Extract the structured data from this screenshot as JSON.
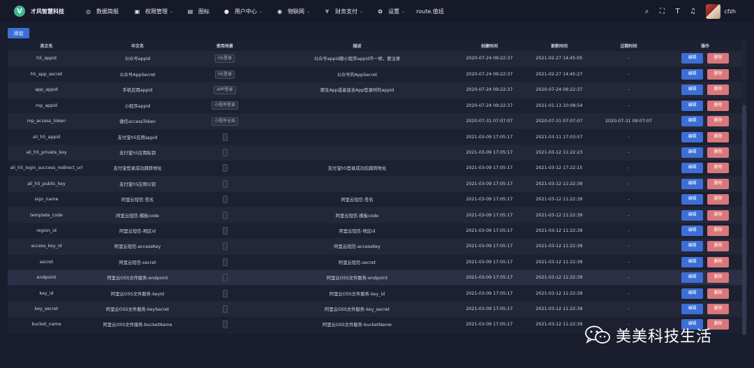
{
  "app": {
    "logo_letter": "V",
    "title": "才风智慧科技"
  },
  "nav": [
    {
      "icon": "dashboard-icon",
      "glyph": "◎",
      "label": "数据简报",
      "dropdown": false
    },
    {
      "icon": "lock-icon",
      "glyph": "▣",
      "label": "权限管理",
      "dropdown": true
    },
    {
      "icon": "picture-icon",
      "glyph": "▤",
      "label": "图标",
      "dropdown": false
    },
    {
      "icon": "user-icon",
      "glyph": "●",
      "label": "用户中心",
      "dropdown": true
    },
    {
      "icon": "iot-icon",
      "glyph": "◉",
      "label": "物联网",
      "dropdown": true
    },
    {
      "icon": "yen-icon",
      "glyph": "¥",
      "label": "财务支付",
      "dropdown": true
    },
    {
      "icon": "settings-icon",
      "glyph": "✿",
      "label": "设置",
      "dropdown": true
    },
    {
      "icon": "",
      "glyph": "",
      "label": "route.值班",
      "dropdown": false
    }
  ],
  "toolbar": {
    "username": "cfzh"
  },
  "add_label": "添加",
  "columns": [
    "英文名",
    "中文名",
    "使用场景",
    "描述",
    "创建时间",
    "更新时间",
    "过期时间",
    "操作"
  ],
  "actions": {
    "edit": "编辑",
    "delete": "删除"
  },
  "rows": [
    {
      "en": "h5_appid",
      "cn": "公众号appid",
      "scene": "H5登录",
      "desc": "公众号appid跟小程序appid不一样，要注意",
      "created": "2020-07-24 09:22:37",
      "updated": "2021-02-27 14:45:05",
      "expire": "-"
    },
    {
      "en": "h5_app_secret",
      "cn": "公众号AppSecret",
      "scene": "H5登录",
      "desc": "公众号的AppSecret",
      "created": "2020-07-24 09:22:37",
      "updated": "2021-02-27 14:45:27",
      "expire": "-"
    },
    {
      "en": "app_appid",
      "cn": "手机应用appid",
      "scene": "APP登录",
      "desc": "原生App或者混合App登录时的appid",
      "created": "2020-07-24 09:22:37",
      "updated": "2020-07-24 09:22:37",
      "expire": "-"
    },
    {
      "en": "mp_appid",
      "cn": "小程序appid",
      "scene": "小程序登录",
      "desc": "",
      "created": "2020-07-24 09:22:37",
      "updated": "2021-01-13 10:08:54",
      "expire": "-"
    },
    {
      "en": "mp_access_token",
      "cn": "微信accessToken",
      "scene": "小程序全局",
      "desc": "",
      "created": "2020-07-31 07:07:07",
      "updated": "2020-07-31 07:07:07",
      "expire": "2020-07-31 09:07:07"
    },
    {
      "en": "ali_h5_appid",
      "cn": "支付宝h5应用appid",
      "scene": "",
      "desc": "",
      "created": "2021-03-09 17:05:17",
      "updated": "2021-03-11 17:03:57",
      "expire": "-"
    },
    {
      "en": "ali_h5_private_key",
      "cn": "支付宝h5应用私钥",
      "scene": "",
      "desc": "",
      "created": "2021-03-09 17:05:17",
      "updated": "2021-03-12 11:22:23",
      "expire": "-"
    },
    {
      "en": "ali_h5_login_success_redirect_url",
      "cn": "支付宝登录成功跳转地址",
      "scene": "",
      "desc": "支付宝h5登录成功后跳转地址",
      "created": "2021-03-09 17:05:17",
      "updated": "2021-03-12 17:22:15",
      "expire": "-"
    },
    {
      "en": "ali_h5_public_key",
      "cn": "支付宝h5应用公钥",
      "scene": "",
      "desc": "",
      "created": "2021-03-09 17:05:17",
      "updated": "2021-03-12 11:22:39",
      "expire": "-"
    },
    {
      "en": "sign_name",
      "cn": "阿里云短信-签名",
      "scene": "",
      "desc": "阿里云短信-签名",
      "created": "2021-03-09 17:05:17",
      "updated": "2021-03-12 11:22:39",
      "expire": "-"
    },
    {
      "en": "template_code",
      "cn": "阿里云短信-模板code",
      "scene": "",
      "desc": "阿里云短信-模板code",
      "created": "2021-03-09 17:05:17",
      "updated": "2021-03-12 11:22:39",
      "expire": "-"
    },
    {
      "en": "region_id",
      "cn": "阿里云短信-地区id",
      "scene": "",
      "desc": "阿里云短信-地区id",
      "created": "2021-03-09 17:05:17",
      "updated": "2021-03-12 11:22:39",
      "expire": "-"
    },
    {
      "en": "access_key_id",
      "cn": "阿里云短信-accessKey",
      "scene": "",
      "desc": "阿里云短信-accessKey",
      "created": "2021-03-09 17:05:17",
      "updated": "2021-03-12 11:22:39",
      "expire": "-"
    },
    {
      "en": "secret",
      "cn": "阿里云短信-secret",
      "scene": "",
      "desc": "阿里云短信-secret",
      "created": "2021-03-09 17:05:17",
      "updated": "2021-03-12 11:22:39",
      "expire": "-"
    },
    {
      "en": "endpoint",
      "cn": "阿里云OSS文件服务-endpoint",
      "scene": "",
      "desc": "阿里云OSS文件服务-endpoint",
      "created": "2021-03-09 17:05:17",
      "updated": "2021-03-12 11:22:39",
      "expire": "-"
    },
    {
      "en": "key_id",
      "cn": "阿里云OSS文件服务-keyId",
      "scene": "",
      "desc": "阿里云OSS文件服务-key_id",
      "created": "2021-03-09 17:05:17",
      "updated": "2021-03-12 11:22:39",
      "expire": "-"
    },
    {
      "en": "key_secret",
      "cn": "阿里云OSS文件服务-keySecret",
      "scene": "",
      "desc": "阿里云OSS文件服务-key_secret",
      "created": "2021-03-09 17:05:17",
      "updated": "2021-03-12 11:22:39",
      "expire": "-"
    },
    {
      "en": "bucket_name",
      "cn": "阿里云OSS文件服务-bucketName",
      "scene": "",
      "desc": "阿里云OSS文件服务-bucketName",
      "created": "2021-03-09 17:05:17",
      "updated": "2021-03-12 11:22:39",
      "expire": "-"
    }
  ],
  "highlighted_row": "endpoint",
  "watermark": {
    "text": "美美科技生活",
    "icon": "wechat-icon"
  },
  "colors": {
    "primary": "#3b6fd6",
    "danger": "#d9777a",
    "logo": "#3fb98b",
    "background": "#1a1d2e"
  }
}
